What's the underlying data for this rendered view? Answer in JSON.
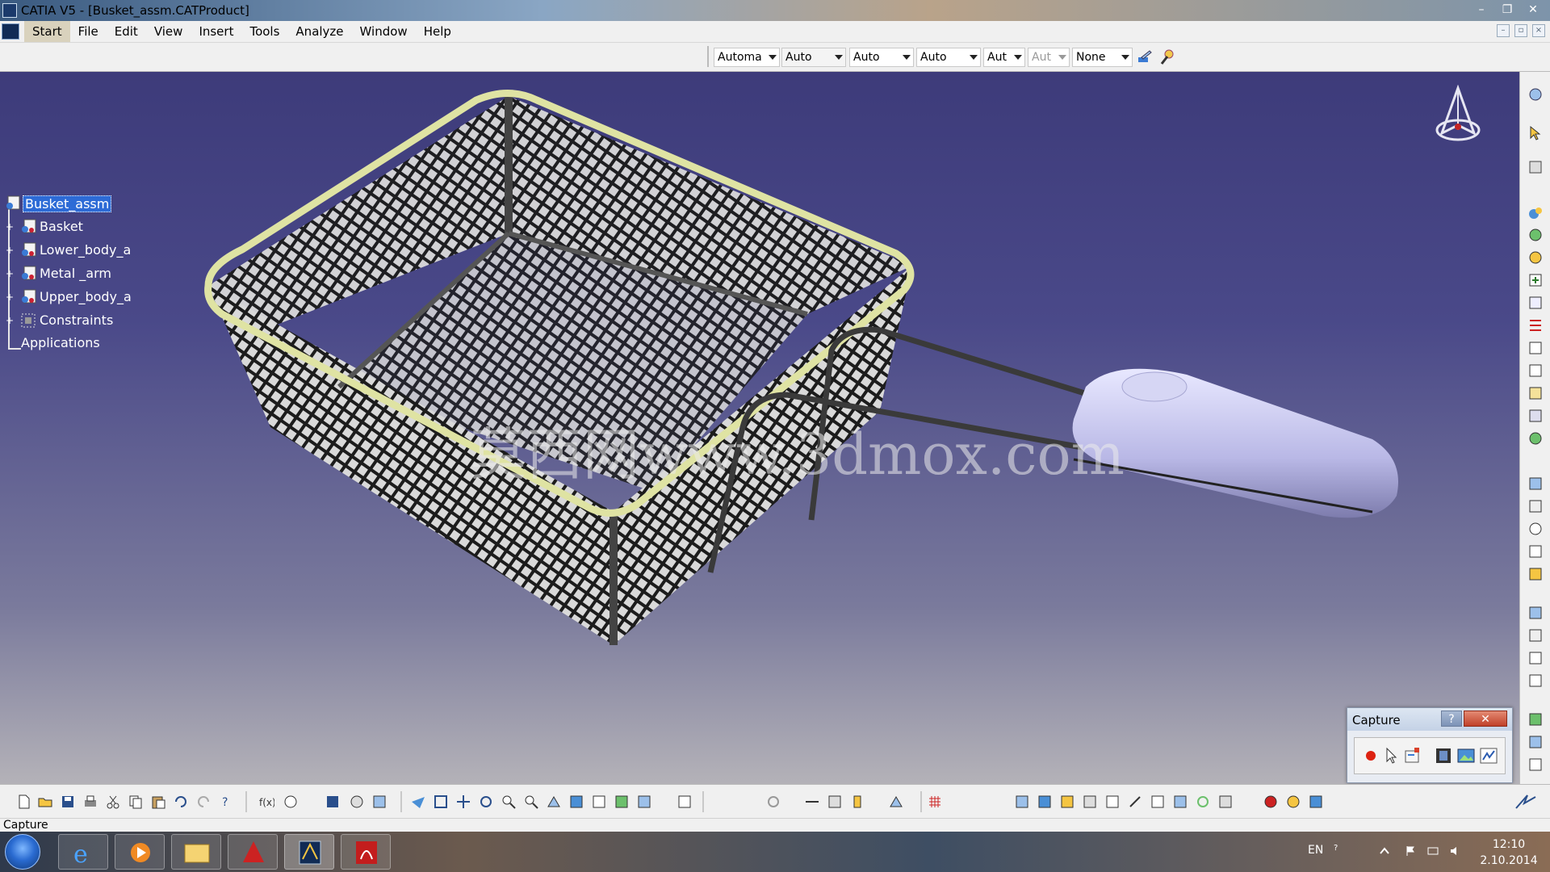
{
  "window": {
    "title": "CATIA V5 - [Busket_assm.CATProduct]",
    "controls": [
      "–",
      "❐",
      "✕"
    ]
  },
  "menu": {
    "items": [
      "Start",
      "File",
      "Edit",
      "View",
      "Insert",
      "Tools",
      "Analyze",
      "Window",
      "Help"
    ],
    "active": "Start",
    "mdi_controls": [
      "–",
      "▫",
      "×"
    ]
  },
  "toolbar_top": {
    "combos": [
      {
        "value": "Automa",
        "enabled": true
      },
      {
        "value": "Auto",
        "enabled": true
      },
      {
        "value": "Auto",
        "enabled": true
      },
      {
        "value": "Auto",
        "enabled": true
      },
      {
        "value": "Aut",
        "enabled": true
      },
      {
        "value": "Aut",
        "enabled": false
      },
      {
        "value": "None",
        "enabled": true
      }
    ],
    "icons": [
      "painter-icon",
      "format-brush-icon"
    ]
  },
  "tree": {
    "root": "Busket_assm",
    "children": [
      "Basket",
      "Lower_body_a",
      "Metal _arm",
      "Upper_body_a",
      "Constraints"
    ],
    "applications": "Applications"
  },
  "watermark": "莫西网www.3dmox.com",
  "capture_dialog": {
    "title": "Capture",
    "help": "?",
    "close": "✕",
    "tools": [
      "record-icon",
      "select-icon",
      "capture-settings-icon",
      "shaded-capture-icon",
      "image-album-icon",
      "options-icon"
    ]
  },
  "status": {
    "text": "Capture"
  },
  "taskbar": {
    "apps": [
      "internet-explorer-icon",
      "media-player-icon",
      "file-explorer-icon",
      "autodesk-icon",
      "catia-icon",
      "acrobat-icon"
    ],
    "active_app": "catia-icon",
    "language": "EN",
    "time": "12:10",
    "date": "2.10.2014"
  },
  "colors": {
    "selection": "#2d6bd6",
    "viewport_top": "#3d3b7a",
    "viewport_bottom": "#b4b2b8",
    "rim": "#e3e7a8",
    "handle": "#c8c8ec"
  }
}
